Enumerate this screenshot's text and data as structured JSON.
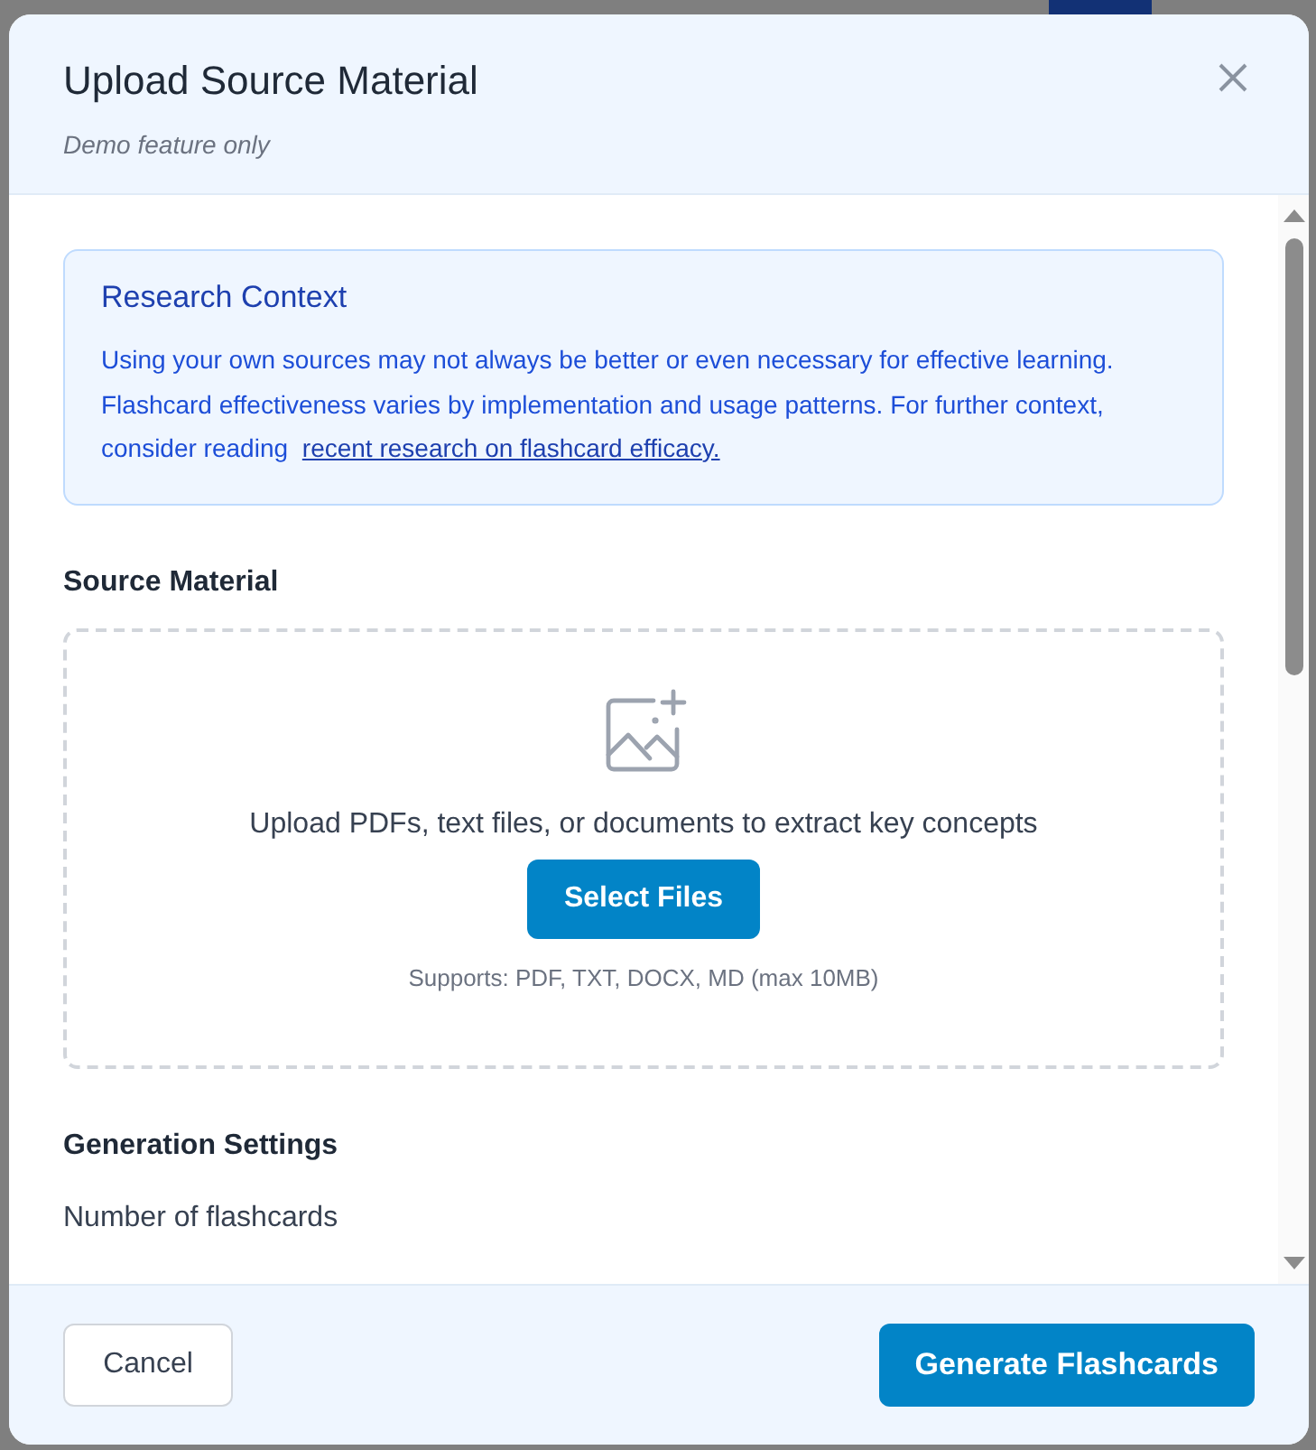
{
  "modal": {
    "title": "Upload Source Material",
    "subtitle": "Demo feature only",
    "notice": {
      "title": "Research Context",
      "text": "Using your own sources may not always be better or even necessary for effective learning. Flashcard effectiveness varies by implementation and usage patterns. For further context, consider reading ",
      "link": "recent research on flashcard efficacy."
    },
    "source_heading": "Source Material",
    "dropzone": {
      "text": "Upload PDFs, text files, or documents to extract key concepts",
      "button": "Select Files",
      "hint": "Supports: PDF, TXT, DOCX, MD (max 10MB)"
    },
    "settings_heading": "Generation Settings",
    "count_label": "Number of flashcards",
    "cancel_button": "Cancel",
    "generate_button": "Generate Flashcards"
  }
}
